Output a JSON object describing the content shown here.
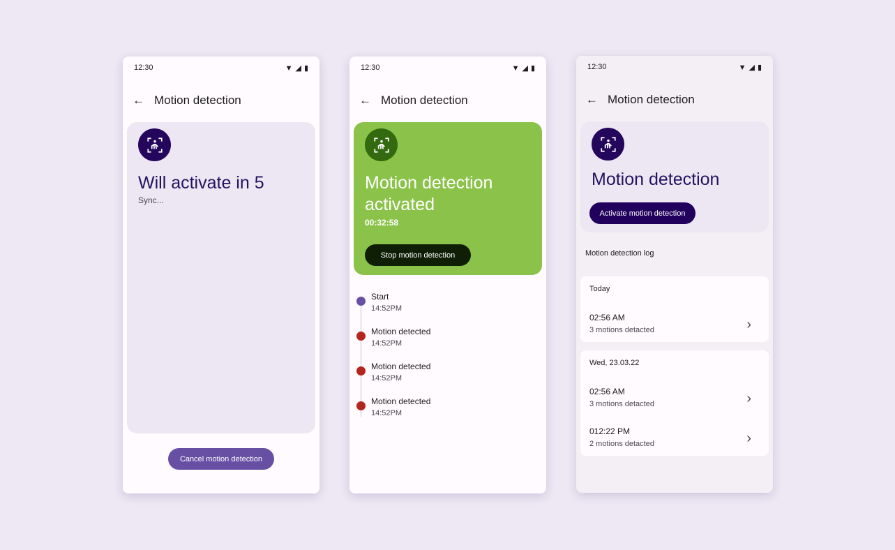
{
  "status": {
    "time": "12:30"
  },
  "app_title": "Motion detection",
  "screen1": {
    "title": "Will activate in 5",
    "subtitle": "Sync...",
    "cancel_label": "Cancel motion detection"
  },
  "screen2": {
    "title": "Motion detection activated",
    "timer": "00:32:58",
    "stop_label": "Stop motion detection",
    "timeline": [
      {
        "label": "Start",
        "time": "14:52PM",
        "type": "start"
      },
      {
        "label": "Motion detected",
        "time": "14:52PM",
        "type": "motion"
      },
      {
        "label": "Motion detected",
        "time": "14:52PM",
        "type": "motion"
      },
      {
        "label": "Motion detected",
        "time": "14:52PM",
        "type": "motion"
      }
    ]
  },
  "screen3": {
    "title": "Motion detection",
    "activate_label": "Activate motion detection",
    "log_label": "Motion detection log",
    "groups": [
      {
        "header": "Today",
        "entries": [
          {
            "time": "02:56 AM",
            "count": "3 motions detacted"
          }
        ]
      },
      {
        "header": "Wed, 23.03.22",
        "entries": [
          {
            "time": "02:56 AM",
            "count": "3 motions detacted"
          },
          {
            "time": "012:22 PM",
            "count": "2 motions detacted"
          }
        ]
      }
    ]
  },
  "colors": {
    "primary": "#6750a4",
    "dark_primary": "#24065c",
    "green": "#8bc34a",
    "dark_green": "#336a10",
    "red": "#b3261e"
  },
  "icons": {
    "back": "arrow-left",
    "motion": "person-motion-frame",
    "chevron": "chevron-right"
  }
}
